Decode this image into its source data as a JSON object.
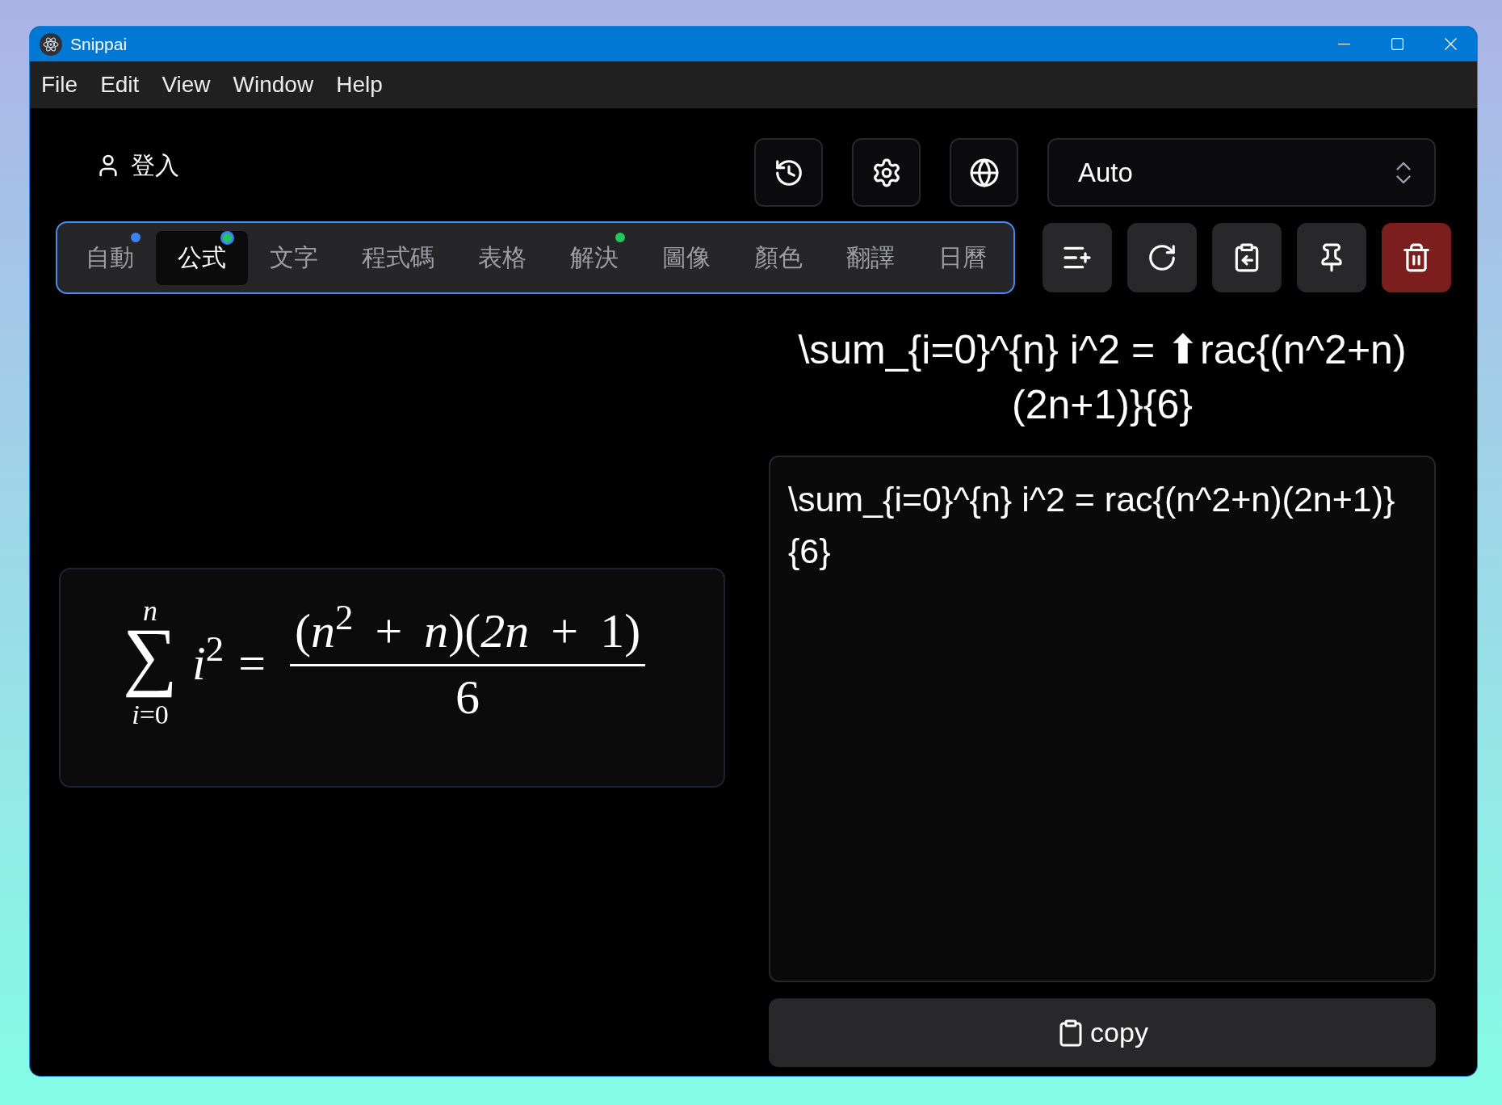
{
  "window": {
    "title": "Snippai"
  },
  "menu": [
    "File",
    "Edit",
    "View",
    "Window",
    "Help"
  ],
  "account": {
    "label": "登入"
  },
  "mode_select": {
    "value": "Auto"
  },
  "tabs": [
    {
      "label": "自動",
      "selected": false,
      "dots": [
        {
          "color": "#3b82f6"
        }
      ]
    },
    {
      "label": "公式",
      "selected": true,
      "dots": [
        {
          "color": "#3b82f6"
        },
        {
          "color": "#22c55e"
        }
      ]
    },
    {
      "label": "文字",
      "selected": false
    },
    {
      "label": "程式碼",
      "selected": false
    },
    {
      "label": "表格",
      "selected": false
    },
    {
      "label": "解決",
      "selected": false,
      "dots": [
        {
          "color": "#22c55e"
        }
      ]
    },
    {
      "label": "圖像",
      "selected": false
    },
    {
      "label": "顏色",
      "selected": false
    },
    {
      "label": "翻譯",
      "selected": false
    },
    {
      "label": "日曆",
      "selected": false
    }
  ],
  "formula_preview": {
    "sum_upper": "n",
    "sum_sign": "∑",
    "sum_lower": "*i*=0",
    "summand": "*i*$^{2}$",
    "relation": "=",
    "numerator": "(*n*$^{2}$ + *n*)(*2n* + 1)",
    "denominator": "6"
  },
  "recognized_latex": "\\sum_{i=0}^{n} i^2 = ⬆rac{(n^2+n)(2n+1)}{6}",
  "latex_field": {
    "value": "\\sum_{i=0}^{n} i^2 = rac{(n^2+n)(2n+1)}{6}"
  },
  "copy_button": {
    "label": "copy"
  }
}
